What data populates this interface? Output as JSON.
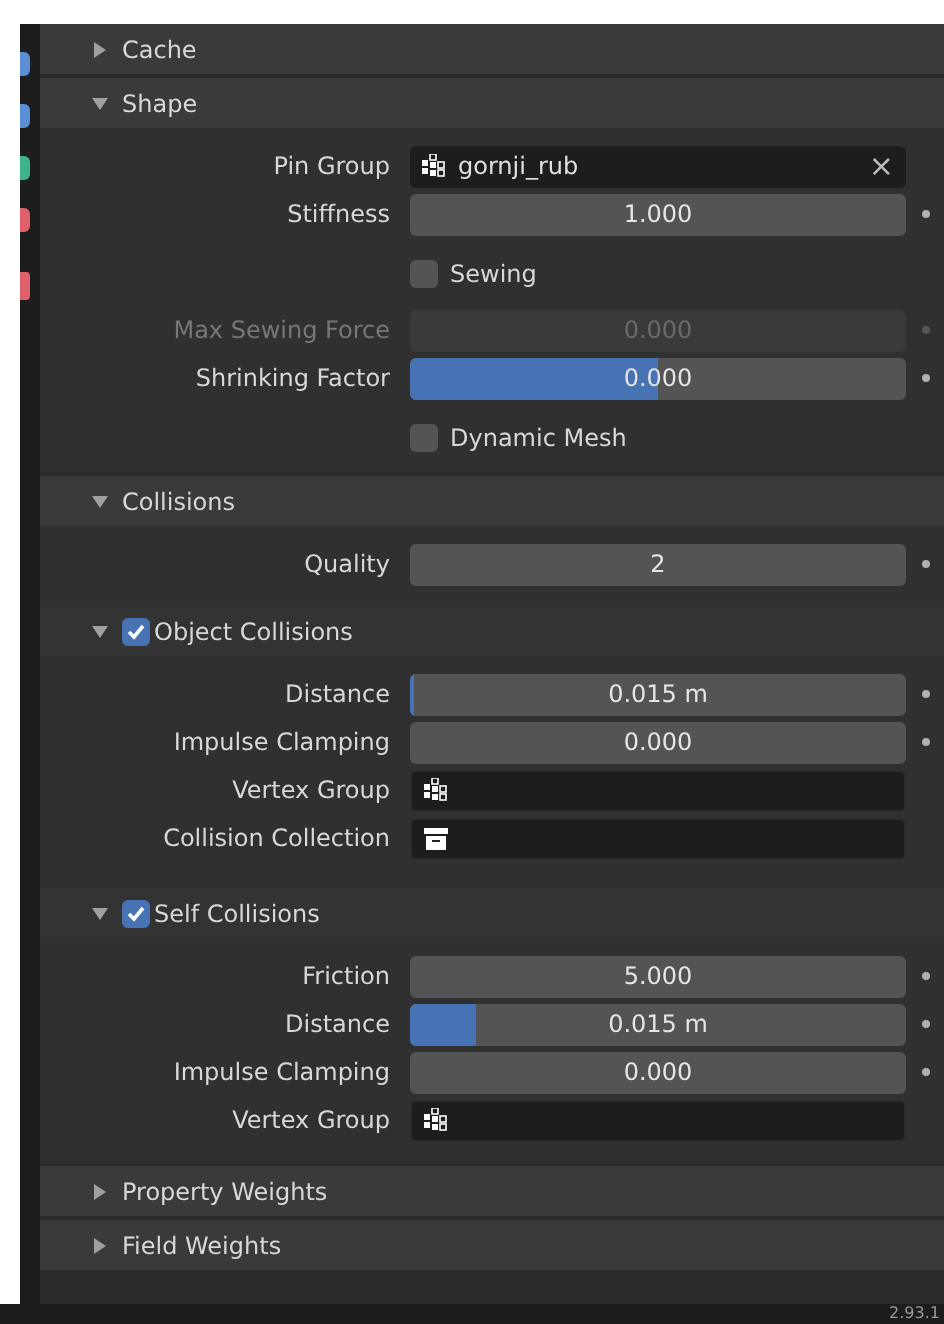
{
  "panels": [
    {
      "title": "Cache",
      "expanded": false
    },
    {
      "title": "Shape",
      "expanded": true,
      "rows": [
        {
          "kind": "search",
          "label": "Pin Group",
          "value": "gornji_rub",
          "clear": "×"
        },
        {
          "kind": "number",
          "label": "Stiffness",
          "value": "1.000",
          "disabled": false
        },
        {
          "kind": "checkbox",
          "label": "Sewing",
          "checked": false
        },
        {
          "kind": "number",
          "label": "Max Sewing Force",
          "value": "0.000",
          "disabled": true
        },
        {
          "kind": "slider",
          "label": "Shrinking Factor",
          "value": "0.000",
          "level": 0.5,
          "disabled": false
        },
        {
          "kind": "checkbox",
          "label": "Dynamic Mesh",
          "checked": false
        }
      ]
    },
    {
      "title": "Collisions",
      "expanded": true,
      "rows": [
        {
          "kind": "number",
          "label": "Quality",
          "value": "2",
          "disabled": false
        }
      ],
      "subpanels": [
        {
          "title": "Object Collisions",
          "expanded": true,
          "checked": true,
          "rows": [
            {
              "kind": "slider",
              "label": "Distance",
              "value": "0.015 m",
              "level": 0.005,
              "disabled": false
            },
            {
              "kind": "number",
              "label": "Impulse Clamping",
              "value": "0.000",
              "disabled": false
            },
            {
              "kind": "vertex_group",
              "label": "Vertex Group"
            },
            {
              "kind": "collection",
              "label": "Collision Collection"
            }
          ]
        },
        {
          "title": "Self Collisions",
          "expanded": true,
          "checked": true,
          "rows": [
            {
              "kind": "number",
              "label": "Friction",
              "value": "5.000",
              "disabled": false
            },
            {
              "kind": "slider",
              "label": "Distance",
              "value": "0.015 m",
              "level": 0.135,
              "disabled": false
            },
            {
              "kind": "number",
              "label": "Impulse Clamping",
              "value": "0.000",
              "disabled": false
            },
            {
              "kind": "vertex_group",
              "label": "Vertex Group"
            }
          ]
        }
      ]
    },
    {
      "title": "Property Weights",
      "expanded": false
    },
    {
      "title": "Field Weights",
      "expanded": false
    }
  ],
  "status_bar": {
    "version": "2.93.1"
  }
}
